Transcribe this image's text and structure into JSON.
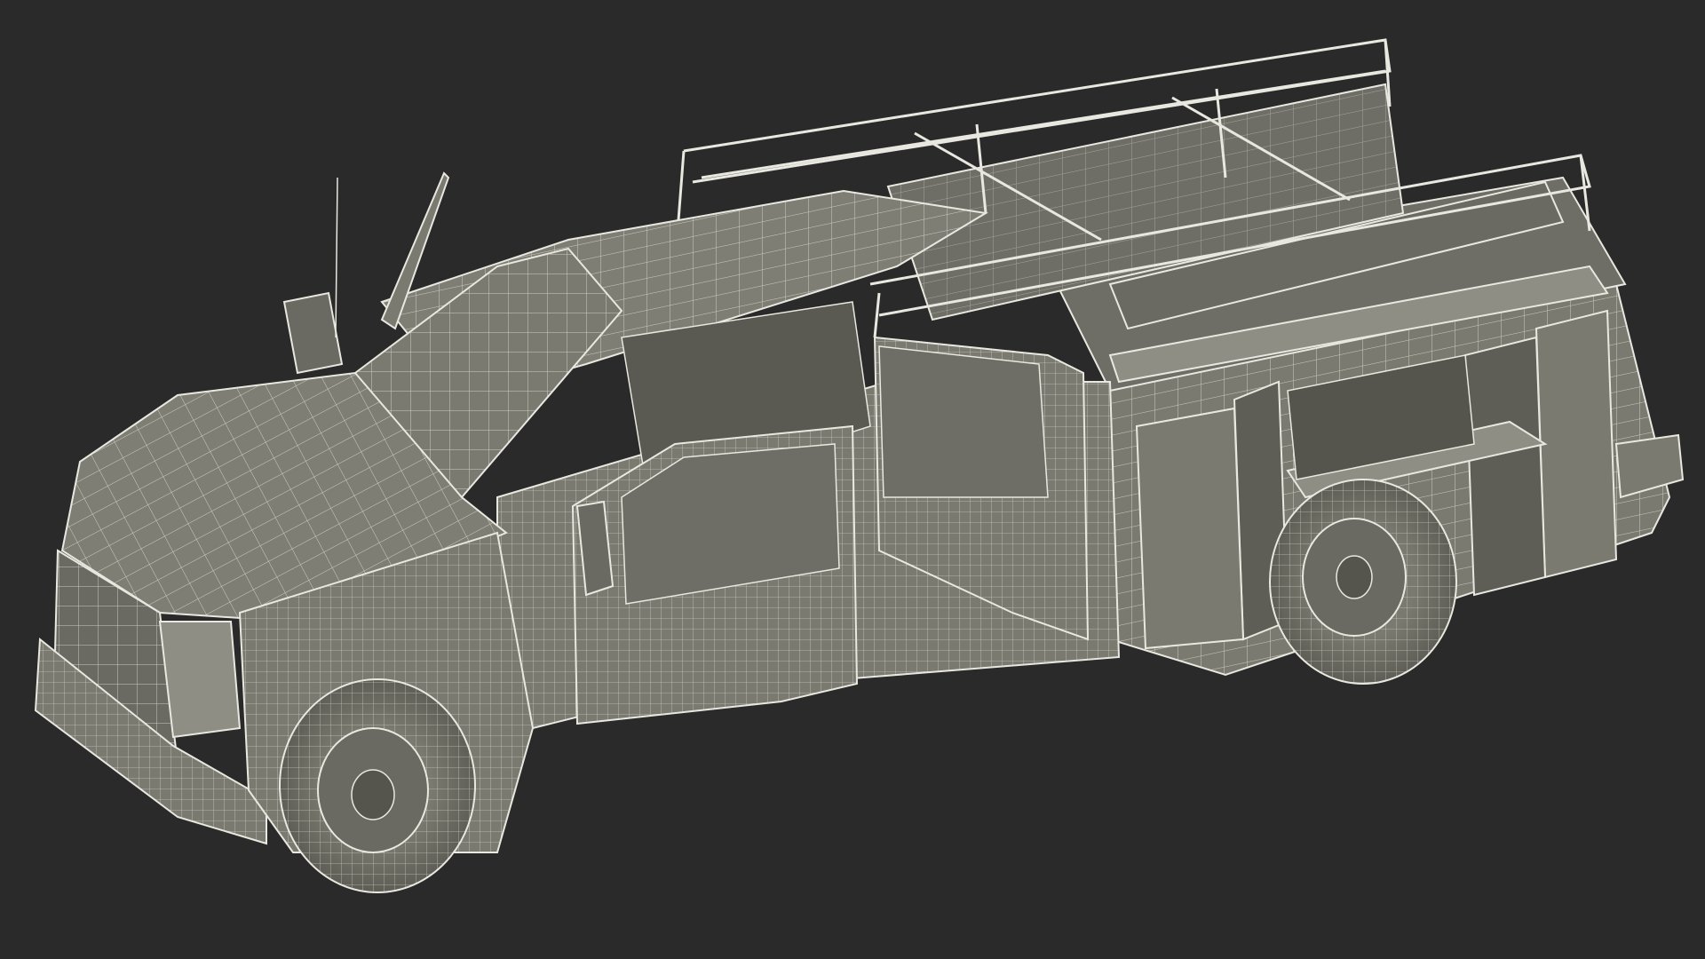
{
  "scene": {
    "subject": "wireframe-utility-truck",
    "colors": {
      "background": "#2a2a2a",
      "surface": "#7a7a70",
      "surface_dark": "#5e5e56",
      "surface_light": "#8e8e84",
      "wire": "#e8e8e0",
      "wire_faint": "#cfcfc5",
      "tire": "#6a6a62"
    }
  }
}
